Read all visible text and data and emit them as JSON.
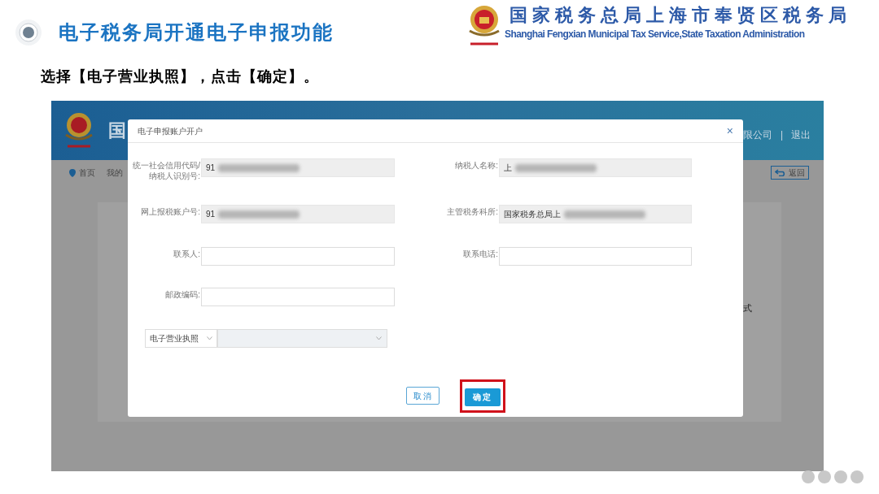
{
  "slide": {
    "title": "电子税务局开通电子申报功能",
    "agency_name": "国家税务总局上海市奉贤区税务局",
    "agency_name_en": "Shanghai Fengxian Municipal Tax Service,State Taxation Administration",
    "instruction": "选择【电子营业执照】，点击【确定】。"
  },
  "background_app": {
    "header_title": "国",
    "user": "限公司",
    "separator": "|",
    "logout": "退出",
    "nav": [
      {
        "label": "首页"
      },
      {
        "label": "我的"
      }
    ],
    "back_button": "返回",
    "partial_text": "式"
  },
  "dialog": {
    "title": "电子申报账户开户",
    "close": "×",
    "fields": [
      {
        "label": "统一社会信用代码/纳税人识别号:",
        "value": "91",
        "readonly": true,
        "redacted": true
      },
      {
        "label": "纳税人名称:",
        "value": "上",
        "readonly": true,
        "redacted": true
      },
      {
        "label": "网上报税账户号:",
        "value": "91",
        "readonly": true,
        "redacted": true
      },
      {
        "label": "主管税务科所:",
        "value": "国家税务总局上",
        "readonly": true,
        "redacted": true
      },
      {
        "label": "联系人:",
        "readonly": false,
        "redacted": false
      },
      {
        "label": "联系电话:",
        "readonly": false,
        "redacted": false
      },
      {
        "label": "邮政编码:",
        "readonly": false,
        "redacted": false
      }
    ],
    "certificate": {
      "type_select": "电子营业执照",
      "option_select": {
        "disabled": true
      }
    },
    "buttons": [
      {
        "label": "取消",
        "kind": "secondary",
        "highlighted": false
      },
      {
        "label": "确定",
        "kind": "primary",
        "highlighted": true
      }
    ]
  }
}
